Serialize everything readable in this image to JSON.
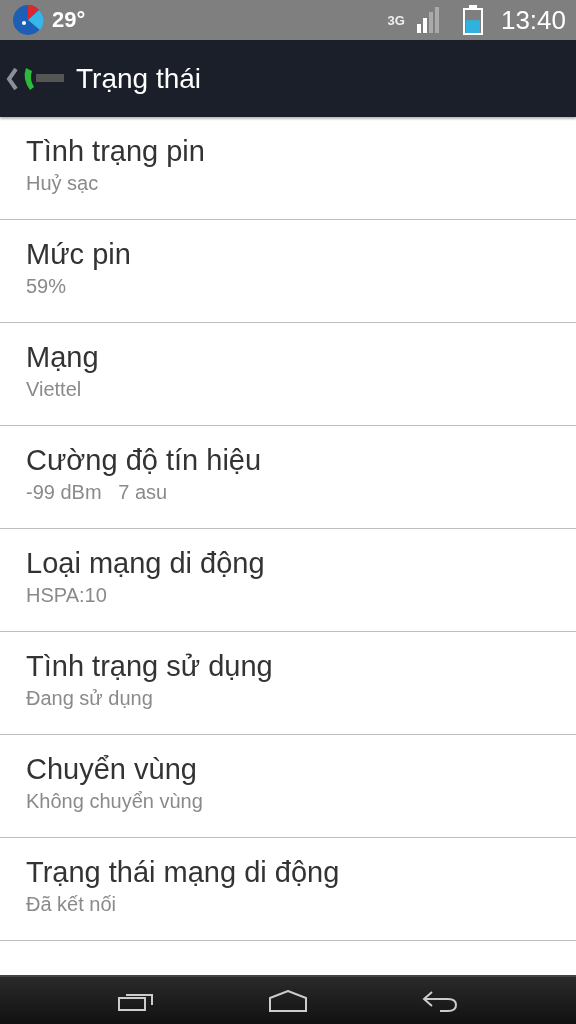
{
  "status_bar": {
    "temperature": "29°",
    "network": "3G",
    "battery": {
      "level": 0.55
    },
    "time": "13:40"
  },
  "action_bar": {
    "title": "Trạng thái"
  },
  "items": [
    {
      "title": "Tình trạng pin",
      "summary": "Huỷ sạc"
    },
    {
      "title": "Mức pin",
      "summary": "59%"
    },
    {
      "title": "Mạng",
      "summary": "Viettel"
    },
    {
      "title": "Cường độ tín hiệu",
      "summary": "-99 dBm   7 asu"
    },
    {
      "title": "Loại mạng di động",
      "summary": "HSPA:10"
    },
    {
      "title": "Tình trạng sử dụng",
      "summary": "Đang sử dụng"
    },
    {
      "title": "Chuyển vùng",
      "summary": "Không chuyển vùng"
    },
    {
      "title": "Trạng thái mạng di động",
      "summary": "Đã kết nối"
    }
  ]
}
